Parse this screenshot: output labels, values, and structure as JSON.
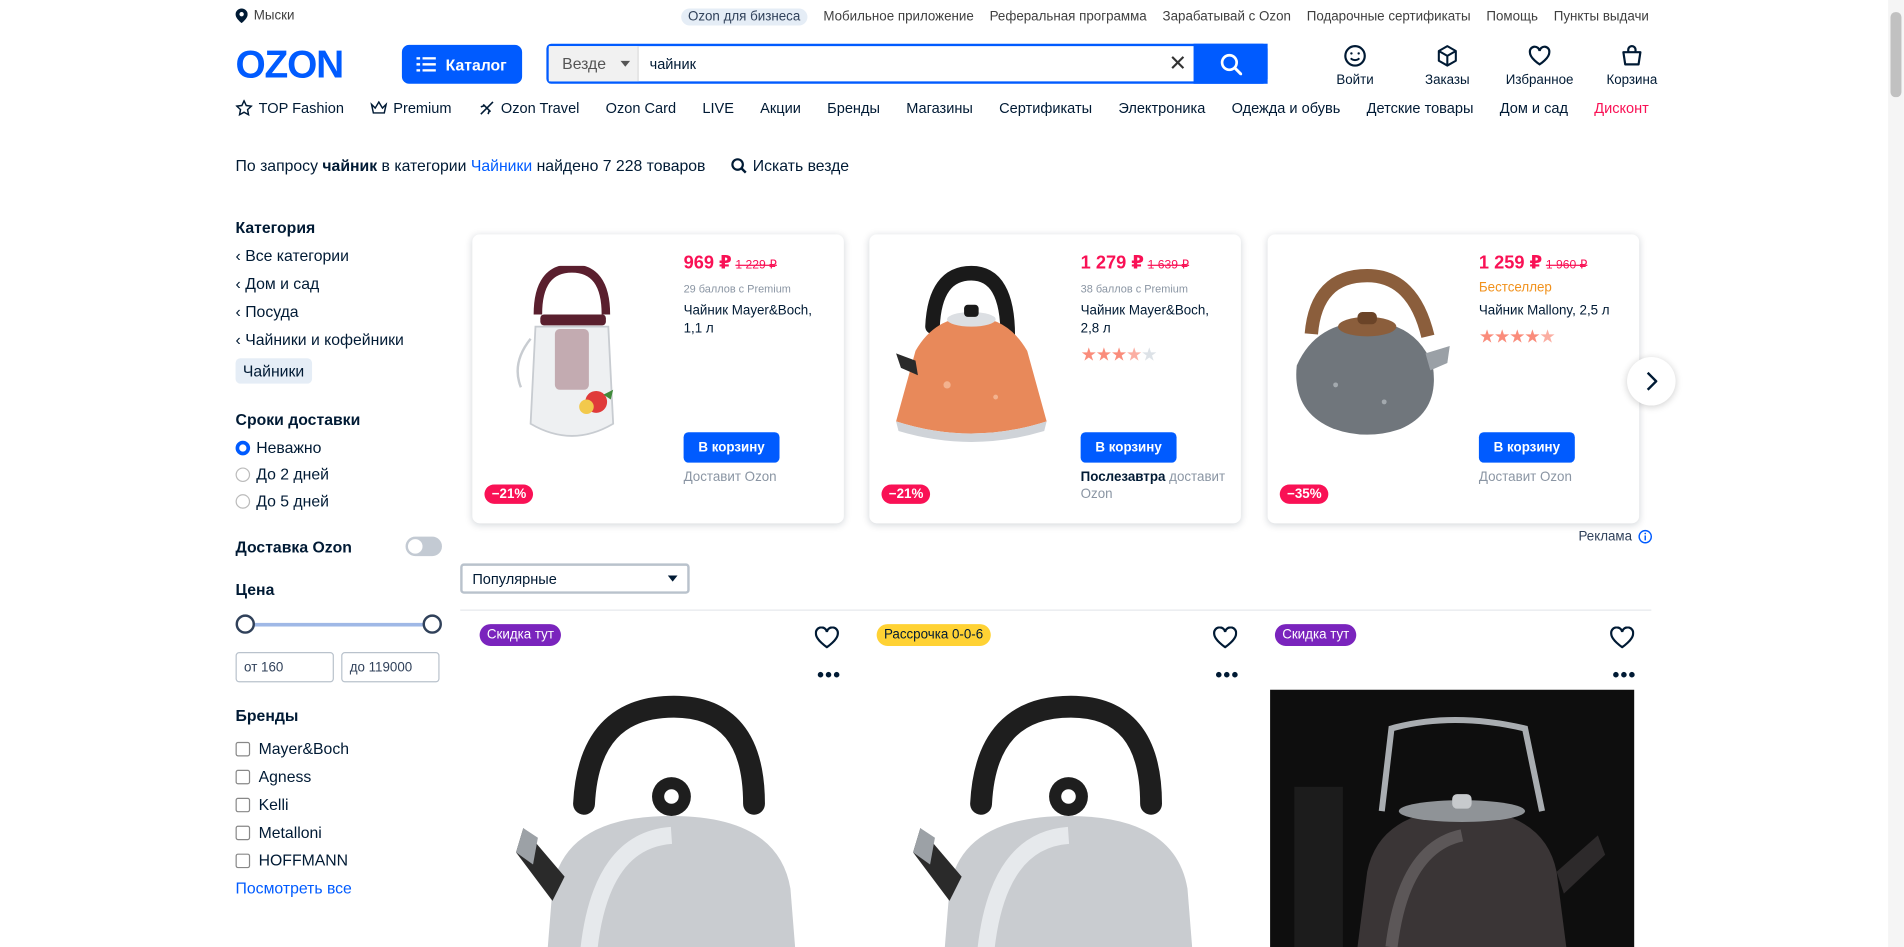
{
  "topbar": {
    "location": "Мыски",
    "links": [
      "Ozon для бизнеса",
      "Мобильное приложение",
      "Реферальная программа",
      "Зарабатывай с Ozon",
      "Подарочные сертификаты",
      "Помощь",
      "Пункты выдачи"
    ]
  },
  "header": {
    "logo": "OZON",
    "catalog": "Каталог",
    "search_scope": "Везде",
    "search_value": "чайник",
    "actions": [
      {
        "label": "Войти",
        "icon": "user-icon"
      },
      {
        "label": "Заказы",
        "icon": "box-icon"
      },
      {
        "label": "Избранное",
        "icon": "heart-icon"
      },
      {
        "label": "Корзина",
        "icon": "cart-icon"
      }
    ]
  },
  "nav": [
    "TOP Fashion",
    "Premium",
    "Ozon Travel",
    "Ozon Card",
    "LIVE",
    "Акции",
    "Бренды",
    "Магазины",
    "Сертификаты",
    "Электроника",
    "Одежда и обувь",
    "Детские товары",
    "Дом и сад",
    "Дисконт"
  ],
  "results": {
    "prefix": "По запросу ",
    "query": "чайник",
    "mid": " в категории ",
    "category": "Чайники",
    "suffix": " найдено 7 228 товаров",
    "search_everywhere": "Искать везде"
  },
  "sidebar": {
    "category_title": "Категория",
    "crumbs": [
      "Все категории",
      "Дом и сад",
      "Посуда",
      "Чайники и кофейники"
    ],
    "current": "Чайники",
    "delivery_title": "Сроки доставки",
    "delivery_options": [
      "Неважно",
      "До 2 дней",
      "До 5 дней"
    ],
    "ozon_delivery": "Доставка Ozon",
    "price_title": "Цена",
    "price_from": "от 160",
    "price_to": "до 119000",
    "brands_title": "Бренды",
    "brands": [
      "Mayer&Boch",
      "Agness",
      "Kelli",
      "Metalloni",
      "HOFFMANN"
    ],
    "see_all": "Посмотреть все"
  },
  "ads": [
    {
      "price": "969 ₽",
      "old": "1 229 ₽",
      "points": "29 баллов с Premium",
      "name": "Чайник Mayer&Boch, 1,1 л",
      "button": "В корзину",
      "delivery": "Доставит Ozon",
      "discount": "−21%"
    },
    {
      "price": "1 279 ₽",
      "old": "1 639 ₽",
      "points": "38 баллов с Premium",
      "name": "Чайник Mayer&Boch, 2,8 л",
      "rating": 3.5,
      "button": "В корзину",
      "delivery_bold": "Послезавтра",
      "delivery": " доставит Ozon",
      "discount": "−21%"
    },
    {
      "price": "1 259 ₽",
      "old": "1 960 ₽",
      "tag": "Бестселлер",
      "name": "Чайник Mallony, 2,5 л",
      "rating": 4.5,
      "button": "В корзину",
      "delivery": "Доставит Ozon",
      "discount": "−35%"
    }
  ],
  "ad_label": "Реклама",
  "sort": "Популярные",
  "products": [
    {
      "badge": "Скидка тут"
    },
    {
      "badge": "Рассрочка 0-0-6"
    },
    {
      "badge": "Скидка тут"
    }
  ],
  "colors": {
    "accent": "#005bff",
    "price": "#f91155",
    "promo": "#7a24bd",
    "installment": "#ffd234",
    "bestseller": "#f1911c"
  }
}
